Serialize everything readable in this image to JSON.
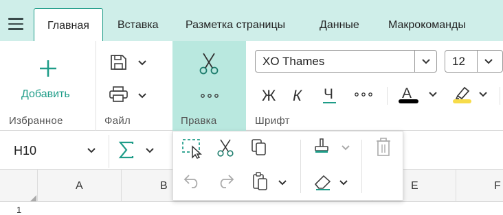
{
  "tabs": [
    {
      "label": "Главная",
      "active": true
    },
    {
      "label": "Вставка",
      "active": false
    },
    {
      "label": "Разметка страницы",
      "active": false
    },
    {
      "label": "Данные",
      "active": false
    },
    {
      "label": "Макрокоманды",
      "active": false
    }
  ],
  "ribbon": {
    "favorites": {
      "add_label": "Добавить",
      "group_label": "Избранное"
    },
    "file": {
      "group_label": "Файл"
    },
    "edit": {
      "group_label": "Правка"
    },
    "font": {
      "group_label": "Шрифт",
      "font_name": "XO Thames",
      "font_size": "12"
    }
  },
  "formula_bar": {
    "cell_ref": "H10"
  },
  "columns": [
    "A",
    "B",
    "E",
    "F"
  ],
  "rows": [
    "1"
  ],
  "colors": {
    "accent": "#1e9c88",
    "tab_bar": "#cfeee9",
    "edit_group_bg": "#b9e8df",
    "font_color_bar": "#000000",
    "highlight_color_bar": "#f7dc4a"
  },
  "icons": {
    "menu": "hamburger-icon",
    "add": "plus-icon",
    "save": "save-icon",
    "print": "print-icon",
    "cut": "scissors-icon",
    "more": "more-icon",
    "bold": "bold-icon",
    "italic": "italic-icon",
    "underline": "underline-icon",
    "font_color": "font-color-icon",
    "highlight": "highlighter-icon",
    "sum": "sigma-icon",
    "select": "select-icon",
    "copy": "copy-icon",
    "paste": "paste-icon",
    "format_painter": "brush-icon",
    "clear": "eraser-icon",
    "delete": "trash-icon",
    "undo": "undo-icon",
    "redo": "redo-icon"
  }
}
